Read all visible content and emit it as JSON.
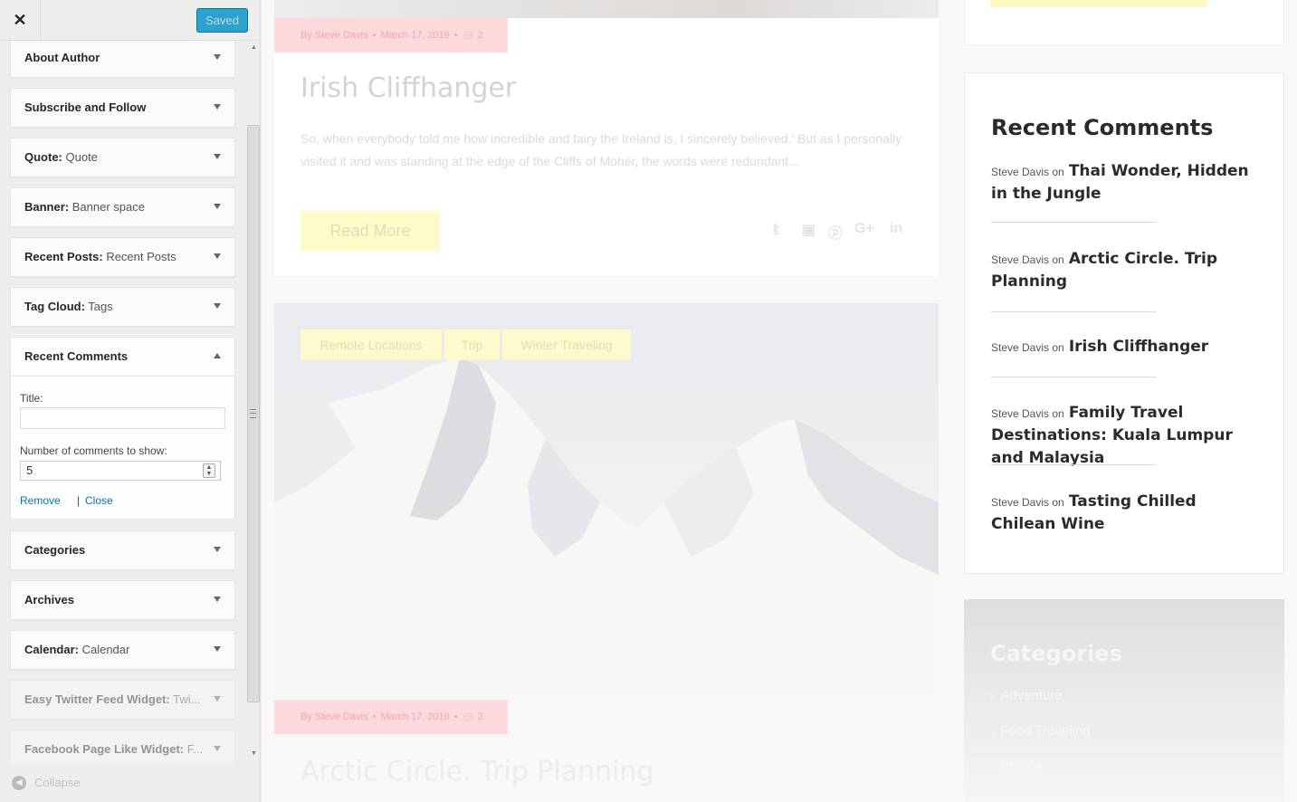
{
  "customizer": {
    "close_label": "✕",
    "save_label": "Saved",
    "collapse_label": "Collapse",
    "widgets": [
      {
        "bold": "About Author",
        "sub": ""
      },
      {
        "bold": "Subscribe and Follow",
        "sub": ""
      },
      {
        "bold": "Quote:",
        "sub": " Quote"
      },
      {
        "bold": "Banner:",
        "sub": " Banner space"
      },
      {
        "bold": "Recent Posts:",
        "sub": " Recent Posts"
      },
      {
        "bold": "Tag Cloud:",
        "sub": " Tags"
      },
      {
        "bold": "Recent Comments",
        "sub": ""
      },
      {
        "bold": "Categories",
        "sub": ""
      },
      {
        "bold": "Archives",
        "sub": ""
      },
      {
        "bold": "Calendar:",
        "sub": " Calendar"
      },
      {
        "bold": "Easy Twitter Feed Widget:",
        "sub": " Twi..."
      },
      {
        "bold": "Facebook Page Like Widget:",
        "sub": " F..."
      }
    ],
    "recent_comments_form": {
      "title_label": "Title:",
      "title_value": "",
      "count_label": "Number of comments to show:",
      "count_value": "5",
      "remove_label": "Remove",
      "separator": "|",
      "close_label": "Close"
    }
  },
  "preview": {
    "post1": {
      "meta_author": "By Steve Davis",
      "meta_date": "March 17, 2016",
      "meta_comments": "2",
      "title": "Irish Cliffhanger",
      "excerpt": "So, when everybody told me how incredible and fairy the Ireland is, I sincerely believed.' But as I personally visited it and was standing at the edge of the Cliffs of Moher, the words were redun­dant…",
      "read_more": "Read More"
    },
    "post2": {
      "tags": [
        "Remote Locations",
        "Trip",
        "Winter Traveling"
      ],
      "meta_author": "By Steve Davis",
      "meta_date": "March 17, 2016",
      "meta_comments": "2",
      "title": "Arctic Circle. Trip Planning"
    },
    "recent_comments": {
      "title": "Recent Comments",
      "items": [
        {
          "author": "Steve Davis",
          "on": "on",
          "post": "Thai Wonder, Hidden in the Jungle"
        },
        {
          "author": "Steve Davis",
          "on": "on",
          "post": "Arctic Circle. Trip Plan­ning"
        },
        {
          "author": "Steve Davis",
          "on": "on",
          "post": "Irish Cliffhanger"
        },
        {
          "author": "Steve Davis",
          "on": "on",
          "post": "Family Travel Destina­tions: Kuala Lumpur and Malaysia"
        },
        {
          "author": "Steve Davis",
          "on": "on",
          "post": "Tasting Chilled Chilean Wine"
        }
      ]
    },
    "categories": {
      "title": "Categories",
      "items": [
        "Adventure",
        "Food Traveling",
        "Photos"
      ]
    }
  }
}
